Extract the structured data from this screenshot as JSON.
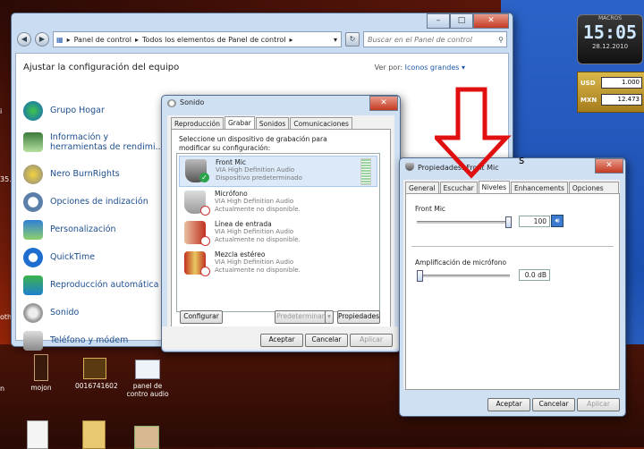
{
  "desktop": {
    "clock": {
      "brand": "MACROS",
      "time": "15:05",
      "date": "28.12.2010"
    },
    "currency": [
      {
        "code": "USD",
        "value": "1.000"
      },
      {
        "code": "MXN",
        "value": "12.473"
      }
    ],
    "icons": [
      {
        "label": "mojon"
      },
      {
        "label": "0016741602"
      },
      {
        "label": "panel de contro audio"
      }
    ],
    "left_edge_fragments": [
      "i",
      "35..",
      "oth",
      "n"
    ]
  },
  "explorer": {
    "breadcrumb": [
      "Panel de control",
      "Todos los elementos de Panel de control"
    ],
    "search_placeholder": "Buscar en el Panel de control",
    "heading": "Ajustar la configuración del equipo",
    "view_label": "Ver por:",
    "view_value": "Iconos grandes",
    "items": [
      {
        "label": "Grupo Hogar"
      },
      {
        "label": "Información y herramientas de rendimi..."
      },
      {
        "label": "Nero BurnRights"
      },
      {
        "label": "Opciones de indización"
      },
      {
        "label": "Personalización"
      },
      {
        "label": "QuickTime"
      },
      {
        "label": "Reproducción automática"
      },
      {
        "label": "Sonido"
      },
      {
        "label": "Teléfono y módem"
      }
    ]
  },
  "sound": {
    "title": "Sonido",
    "tabs": [
      "Reproducción",
      "Grabar",
      "Sonidos",
      "Comunicaciones"
    ],
    "instruction": "Seleccione un dispositivo de grabación para modificar su configuración:",
    "devices": [
      {
        "name": "Front Mic",
        "driver": "VIA High Definition Audio",
        "status": "Dispositivo predeterminado"
      },
      {
        "name": "Micrófono",
        "driver": "VIA High Definition Audio",
        "status": "Actualmente no disponible."
      },
      {
        "name": "Línea de entrada",
        "driver": "VIA High Definition Audio",
        "status": "Actualmente no disponible."
      },
      {
        "name": "Mezcla estéreo",
        "driver": "VIA High Definition Audio",
        "status": "Actualmente no disponible."
      }
    ],
    "configure": "Configurar",
    "set_default": "Predeterminar",
    "properties": "Propiedades",
    "ok": "Aceptar",
    "cancel": "Cancelar",
    "apply": "Aplicar"
  },
  "props": {
    "title": "Propiedades: Front Mic",
    "tabs": [
      "General",
      "Escuchar",
      "Niveles",
      "Enhancements",
      "Opciones avanzadas"
    ],
    "front_mic_label": "Front Mic",
    "front_mic_value": "100",
    "front_mic_level": 1.0,
    "boost_label": "Amplificación de micrófono",
    "boost_value": "0.0 dB",
    "boost_level": 0.0,
    "ok": "Aceptar",
    "cancel": "Cancelar",
    "apply": "Aplicar"
  },
  "colors": {
    "arrow": "#e01010",
    "selection": "#dbe9f9",
    "link": "#1e4f8f"
  }
}
